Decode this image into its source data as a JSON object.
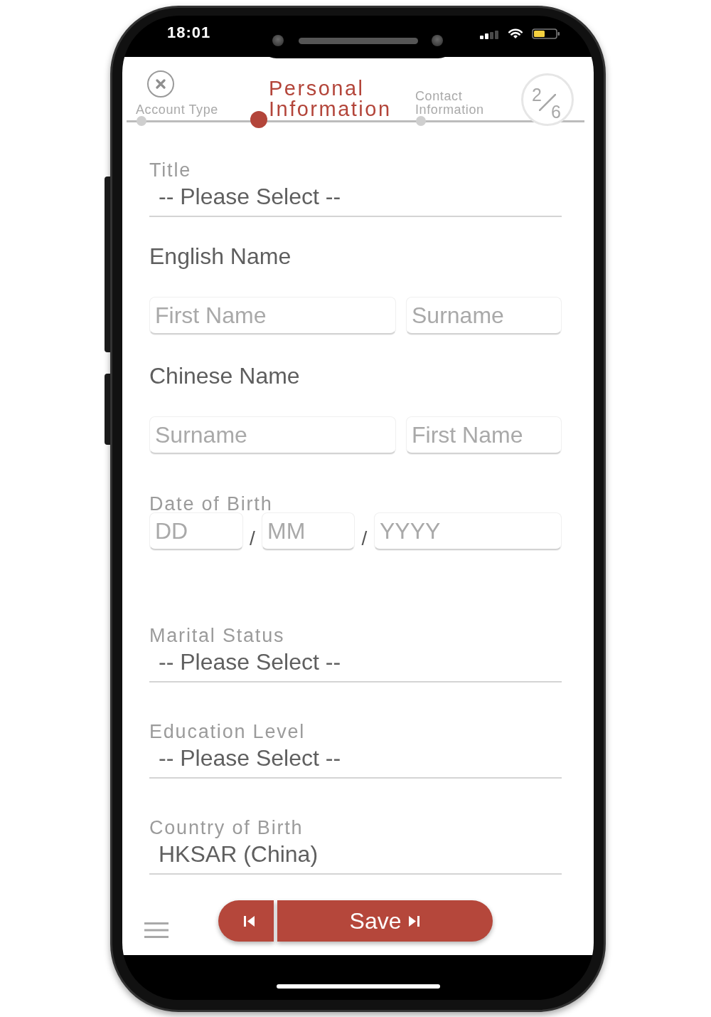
{
  "status_bar": {
    "time": "18:01"
  },
  "steps": [
    {
      "label": "Account Type",
      "selected": false
    },
    {
      "label": "Personal Information",
      "selected": true
    },
    {
      "label": "Contact Information",
      "selected": false
    }
  ],
  "step_counter": {
    "current": "2",
    "total": "6"
  },
  "form": [
    {
      "kind": "select",
      "label": "Title",
      "value": "-- Please Select --"
    },
    {
      "kind": "name",
      "heading": "English Name",
      "inputs": [
        {
          "placeholder": "First Name"
        },
        {
          "placeholder": "Surname"
        }
      ]
    },
    {
      "kind": "name",
      "heading": "Chinese Name",
      "inputs": [
        {
          "placeholder": "Surname"
        },
        {
          "placeholder": "First Name"
        }
      ]
    },
    {
      "kind": "date",
      "label": "Date of Birth",
      "inputs": [
        {
          "placeholder": "DD"
        },
        {
          "placeholder": "MM"
        },
        {
          "placeholder": "YYYY"
        }
      ],
      "separators": [
        "/",
        "/"
      ]
    },
    {
      "kind": "select",
      "label": "Marital Status",
      "value": "-- Please Select --"
    },
    {
      "kind": "select",
      "label": "Education Level",
      "value": "-- Please Select --"
    },
    {
      "kind": "select",
      "label": "Country of Birth",
      "value": "HKSAR (China)"
    }
  ],
  "footer": {
    "save_label": "Save"
  }
}
